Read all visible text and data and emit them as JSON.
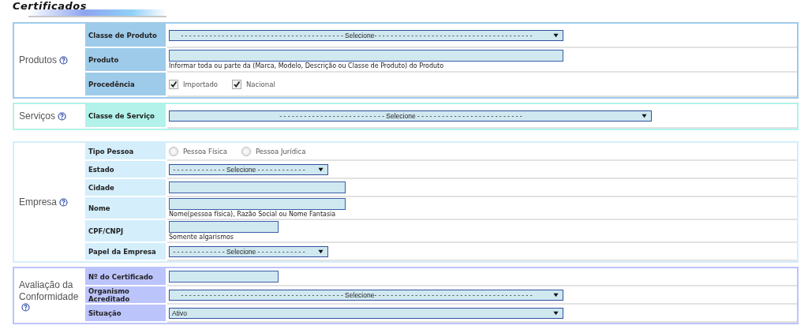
{
  "page_title": "Certificados",
  "sections": [
    {
      "title": "Produtos",
      "color": "#9fcbea",
      "rows": [
        {
          "label": "Classe de Produto",
          "kind": "select",
          "placeholder": "- - - - - - - - - - - - - - - - - - - - - - - - - - - - - - - - - - - - - - - - Selecione- - - - - - - - - - - - - - - - - - - - - - - - - - - - - - - - - - - - - - -"
        },
        {
          "label": "Produto",
          "kind": "text",
          "hint": "Informar toda ou parte da (Marca, Modelo, Descrição ou Classe de Produto) do Produto"
        },
        {
          "label": "Procedência",
          "kind": "checkboxes",
          "options": [
            {
              "label": "Importado",
              "checked": true
            },
            {
              "label": "Nacional",
              "checked": true
            }
          ]
        }
      ]
    },
    {
      "title": "Serviços",
      "color": "#b2f2ea",
      "rows": [
        {
          "label": "Classe de Serviço",
          "kind": "select",
          "placeholder": "- - - - - - - - - - - - - - - - - - - - - - - - - - Selecione - - - - - - - - - - - - - - - - - - - - - - - - - -"
        }
      ]
    },
    {
      "title": "Empresa",
      "color": "#d4eefc",
      "rows": [
        {
          "label": "Tipo Pessoa",
          "kind": "radios",
          "options": [
            {
              "label": "Pessoa Física",
              "selected": false
            },
            {
              "label": "Pessoa Jurídica",
              "selected": false
            }
          ]
        },
        {
          "label": "Estado",
          "kind": "select",
          "placeholder": "- - - - - - - - - - - - - Selecione - - - - - - - - - - - -"
        },
        {
          "label": "Cidade",
          "kind": "text"
        },
        {
          "label": "Nome",
          "kind": "text",
          "hint": "Nome(pessoa física), Razão Social ou Nome Fantasia"
        },
        {
          "label": "CPF/CNPJ",
          "kind": "text",
          "hint": "Somente algarismos"
        },
        {
          "label": "Papel da Empresa",
          "kind": "select",
          "placeholder": "- - - - - - - - - - - - - Selecione - - - - - - - - - - - -"
        }
      ]
    },
    {
      "title": "Avaliação da Conformidade",
      "color": "#bcc4fc",
      "rows": [
        {
          "label": "Nº do Certificado",
          "kind": "text"
        },
        {
          "label": "Organismo Acreditado",
          "kind": "select",
          "placeholder": "- - - - - - - - - - - - - - - - - - - - - - - - - - - - - - - - - - - - - - - - Selecione- - - - - - - - - - - - - - - - - - - - - - - - - - - - - - - - - - - - - - -"
        },
        {
          "label": "Situação",
          "kind": "select",
          "value": "Ativo"
        }
      ]
    }
  ]
}
